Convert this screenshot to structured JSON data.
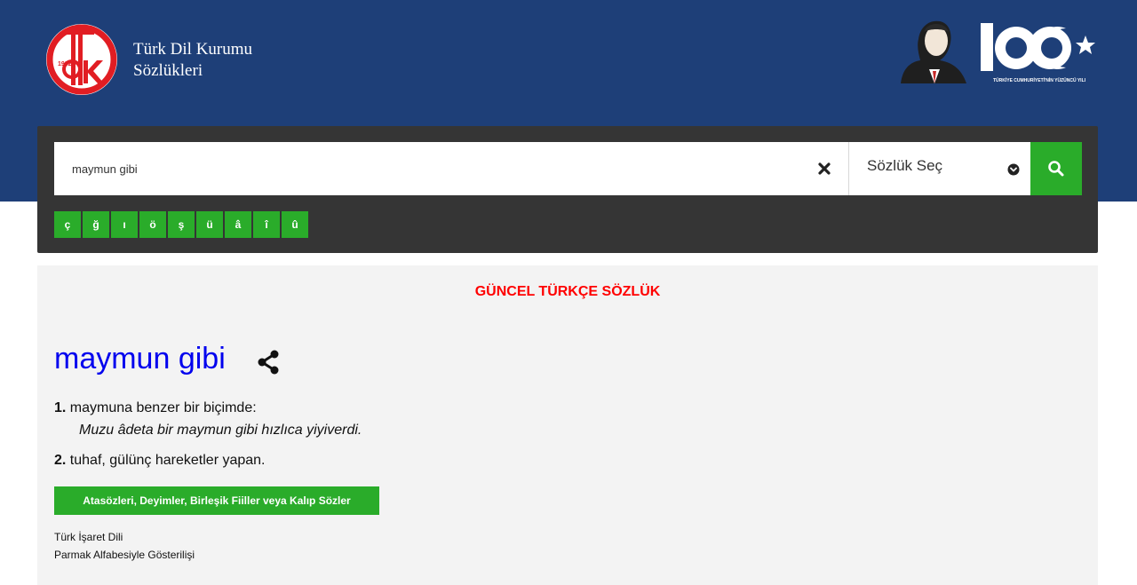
{
  "header": {
    "brand_line1": "Türk Dil Kurumu",
    "brand_line2": "Sözlükleri",
    "logo_year": "1932",
    "centennial_caption": "TÜRKİYE CUMHURİYETİ'NİN YÜZÜNCÜ YILI",
    "colors": {
      "background": "#1e3f78",
      "logo_red": "#e11d23"
    }
  },
  "search": {
    "value": "maymun gibi",
    "clear_icon": "close-icon",
    "dictionary_select": "Sözlük Seç",
    "search_icon": "search-icon",
    "special_chars": [
      "ç",
      "ğ",
      "ı",
      "ö",
      "ş",
      "ü",
      "â",
      "î",
      "û"
    ],
    "colors": {
      "panel": "#353535",
      "button": "#2aac2a"
    }
  },
  "result": {
    "dictionary_title": "GÜNCEL TÜRKÇE SÖZLÜK",
    "word": "maymun gibi",
    "share_icon": "share-icon",
    "meanings": [
      {
        "num": "1.",
        "text": "maymuna benzer bir biçimde:",
        "example": "Muzu âdeta bir maymun gibi hızlıca yiyiverdi."
      },
      {
        "num": "2.",
        "text": "tuhaf, gülünç hareketler yapan.",
        "example": ""
      }
    ],
    "atasozleri_button": "Atasözleri, Deyimler, Birleşik Fiiller veya Kalıp Sözler",
    "sign_language": "Türk İşaret Dili",
    "finger_alphabet": "Parmak Alfabesiyle Gösterilişi",
    "colors": {
      "title": "#ff0000",
      "word": "#0000ee",
      "panel": "#f3f3f3"
    }
  }
}
